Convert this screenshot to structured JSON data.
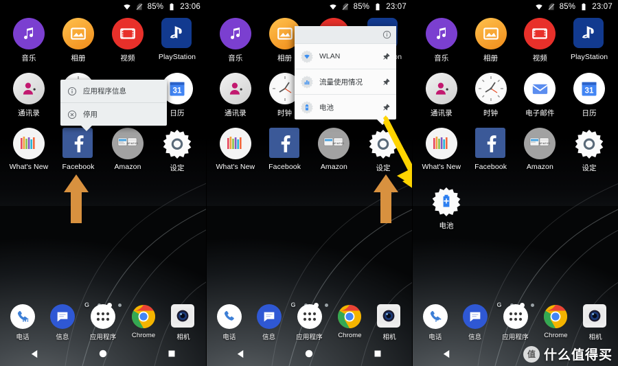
{
  "statusbar": {
    "battery_pct": "85%",
    "times": [
      "23:06",
      "23:07",
      "23:07"
    ],
    "icons": [
      "wifi-icon",
      "no-sim-icon",
      "battery-icon"
    ]
  },
  "home_grid": {
    "row1": [
      {
        "label": "音乐",
        "icon": "music-icon",
        "color": "#7b3fd0"
      },
      {
        "label": "相册",
        "icon": "album-icon",
        "color": "#f5a623"
      },
      {
        "label": "视频",
        "icon": "video-icon",
        "color": "#e8302a"
      },
      {
        "label": "PlayStation",
        "icon": "playstation-icon",
        "color": "#123a8f"
      }
    ],
    "row2": [
      {
        "label": "通讯录",
        "icon": "contacts-icon",
        "color": "#e0e0e0"
      },
      {
        "label": "时钟",
        "icon": "clock-icon",
        "color": "#f2f2f2"
      },
      {
        "label": "电子邮件",
        "icon": "email-icon",
        "color": "#ffffff"
      },
      {
        "label": "日历",
        "icon": "calendar-icon",
        "color": "#ffffff"
      }
    ],
    "row3": [
      {
        "label": "What's New",
        "icon": "whats-new-icon",
        "color": "#f0f0f0"
      },
      {
        "label": "Facebook",
        "icon": "facebook-icon",
        "color": "#3b5998"
      },
      {
        "label": "Amazon",
        "icon": "amazon-icon",
        "color": "#a8a8a8"
      },
      {
        "label": "设定",
        "icon": "settings-gear-icon",
        "color": "#ffffff"
      }
    ],
    "row4_panel3": [
      {
        "label": "电池",
        "icon": "battery-settings-shortcut-icon",
        "color": "#ffffff"
      }
    ]
  },
  "dock": {
    "items": [
      {
        "label": "电话",
        "icon": "phone-icon"
      },
      {
        "label": "信息",
        "icon": "messages-icon"
      },
      {
        "label": "应用程序",
        "icon": "app-drawer-icon"
      },
      {
        "label": "Chrome",
        "icon": "chrome-icon"
      },
      {
        "label": "相机",
        "icon": "camera-icon"
      }
    ],
    "page_indicator": {
      "google_letter": "G",
      "count": 3,
      "active_index": 1
    }
  },
  "navbar": {
    "items": [
      {
        "name": "back-button",
        "glyph": "◀"
      },
      {
        "name": "home-button",
        "glyph": "●"
      },
      {
        "name": "recents-button",
        "glyph": "■"
      }
    ]
  },
  "context_menu": {
    "items": [
      {
        "label": "应用程序信息",
        "icon": "info-circle-icon"
      },
      {
        "label": "停用",
        "icon": "disable-circle-x-icon"
      }
    ]
  },
  "shortcut_popup": {
    "header_icon": "info-circle-icon",
    "items": [
      {
        "label": "WLAN",
        "icon": "wifi-shortcut-icon",
        "pin": "pin-icon"
      },
      {
        "label": "流量使用情况",
        "icon": "data-usage-shortcut-icon",
        "pin": "pin-icon"
      },
      {
        "label": "电池",
        "icon": "battery-shortcut-icon",
        "pin": "pin-icon"
      }
    ]
  },
  "annotations": {
    "orange_arrow_color": "#d8913f",
    "yellow_arrow_color": "#ffd400",
    "orange_arrow_targets": [
      "Facebook",
      "设定"
    ],
    "yellow_arrow_target": "电池"
  },
  "watermark": {
    "badge": "值",
    "text": "什么值得买"
  }
}
